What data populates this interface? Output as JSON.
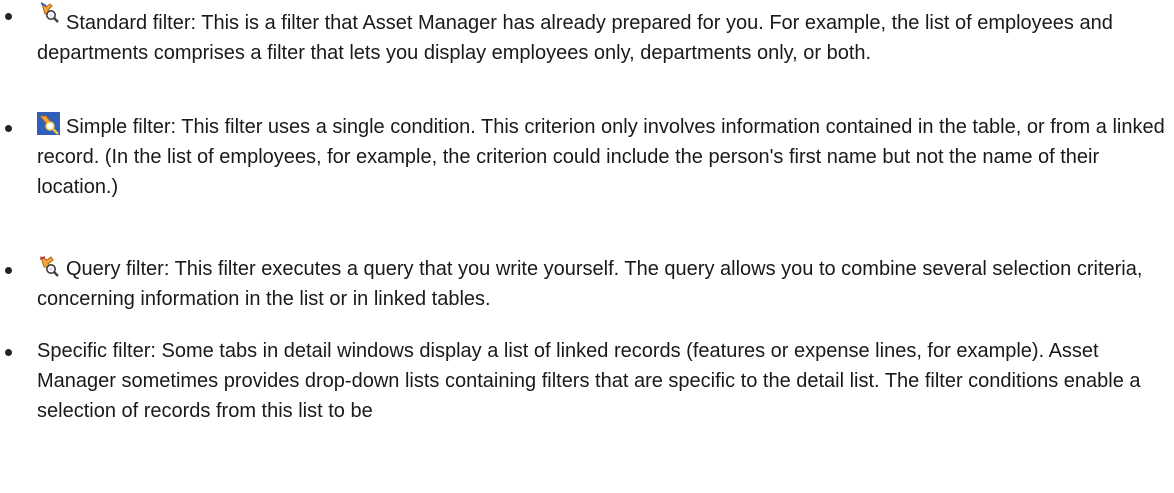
{
  "filters": [
    {
      "icon": "standard-filter-icon",
      "title": "Standard filter",
      "description": ": This is a filter that Asset Manager has already prepared for you. For example, the list of employees and departments comprises a filter that lets you display employees only, departments only, or both."
    },
    {
      "icon": "simple-filter-icon",
      "title": "Simple filter",
      "description": ": This filter uses a single condition. This criterion only involves information contained in the table, or from a linked record. (In the list of employees, for example, the criterion could include the person's first name but not the name of their location.)"
    },
    {
      "icon": "query-filter-icon",
      "title": "Query filter",
      "description": ": This filter executes a query that you write yourself. The query allows you to combine several selection criteria, concerning information in the list or in linked tables."
    },
    {
      "title": "Specific filter",
      "description": ": Some tabs in detail windows display a list of linked records (features or expense lines, for example). Asset Manager sometimes provides drop-down lists containing filters that are specific to the detail list. The filter conditions enable a selection of records from this list to be"
    }
  ]
}
